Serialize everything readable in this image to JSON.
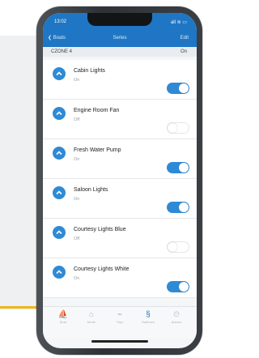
{
  "colors": {
    "accent": "#1f76c4",
    "toggle_on": "#2f8ad6",
    "highlight_line": "#f2b418"
  },
  "status": {
    "time": "13:02",
    "signal": "all ≋ ▭"
  },
  "nav": {
    "back_label": "❮ Boats",
    "title": "Series",
    "edit_label": "Edit"
  },
  "zone": {
    "name": "CZONE 4",
    "state": "On"
  },
  "rows": [
    {
      "name": "Cabin Lights",
      "state": "On",
      "on": true
    },
    {
      "name": "Engine Room Fan",
      "state": "Off",
      "on": false
    },
    {
      "name": "Fresh Water Pump",
      "state": "On",
      "on": true
    },
    {
      "name": "Saloon Lights",
      "state": "On",
      "on": true
    },
    {
      "name": "Courtesy Lights Blue",
      "state": "Off",
      "on": false
    },
    {
      "name": "Courtesy Lights White",
      "state": "On",
      "on": true
    }
  ],
  "tabs": [
    {
      "label": "Boat",
      "icon": "boat-icon",
      "glyph": "⛵"
    },
    {
      "label": "Mode",
      "icon": "home-icon",
      "glyph": "⌂"
    },
    {
      "label": "Trips",
      "icon": "chart-icon",
      "glyph": "⌁"
    },
    {
      "label": "Switches",
      "icon": "switch-icon",
      "glyph": "§"
    },
    {
      "label": "Alarms",
      "icon": "alarm-icon",
      "glyph": "⏲"
    }
  ]
}
